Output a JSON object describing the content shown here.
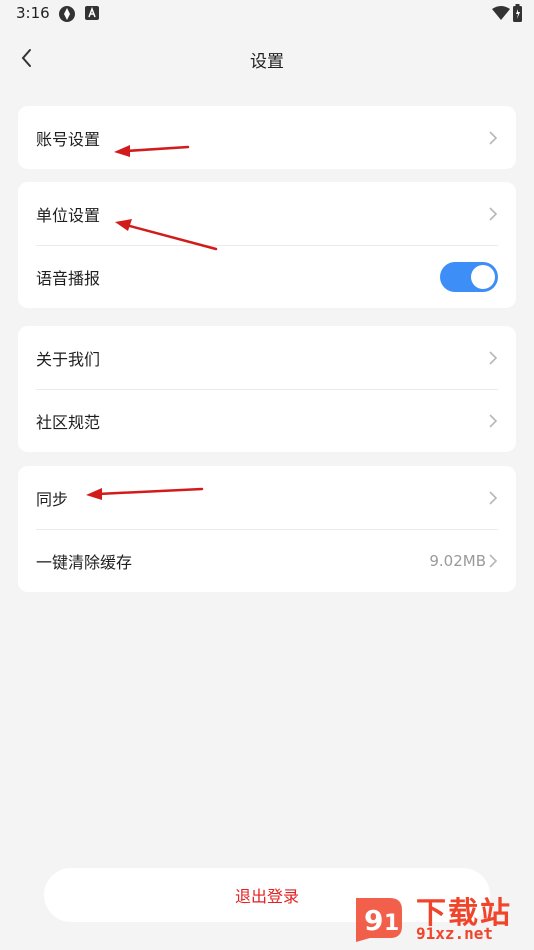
{
  "status_bar": {
    "time": "3:16"
  },
  "nav": {
    "title": "设置"
  },
  "groups": [
    {
      "rows": [
        {
          "label": "账号设置"
        }
      ]
    },
    {
      "rows": [
        {
          "label": "单位设置"
        },
        {
          "label": "语音播报",
          "toggle_on": true
        }
      ]
    },
    {
      "rows": [
        {
          "label": "关于我们"
        },
        {
          "label": "社区规范"
        }
      ]
    },
    {
      "rows": [
        {
          "label": "同步"
        },
        {
          "label": "一键清除缓存",
          "value": "9.02MB"
        }
      ]
    }
  ],
  "logout": {
    "label": "退出登录"
  },
  "watermark": {
    "top": "下载站",
    "bottom": "91xz.net"
  },
  "colors": {
    "accent": "#3e8ef7",
    "danger": "#e32121",
    "annotation": "#d21b1b",
    "background": "#f4f4f4"
  }
}
